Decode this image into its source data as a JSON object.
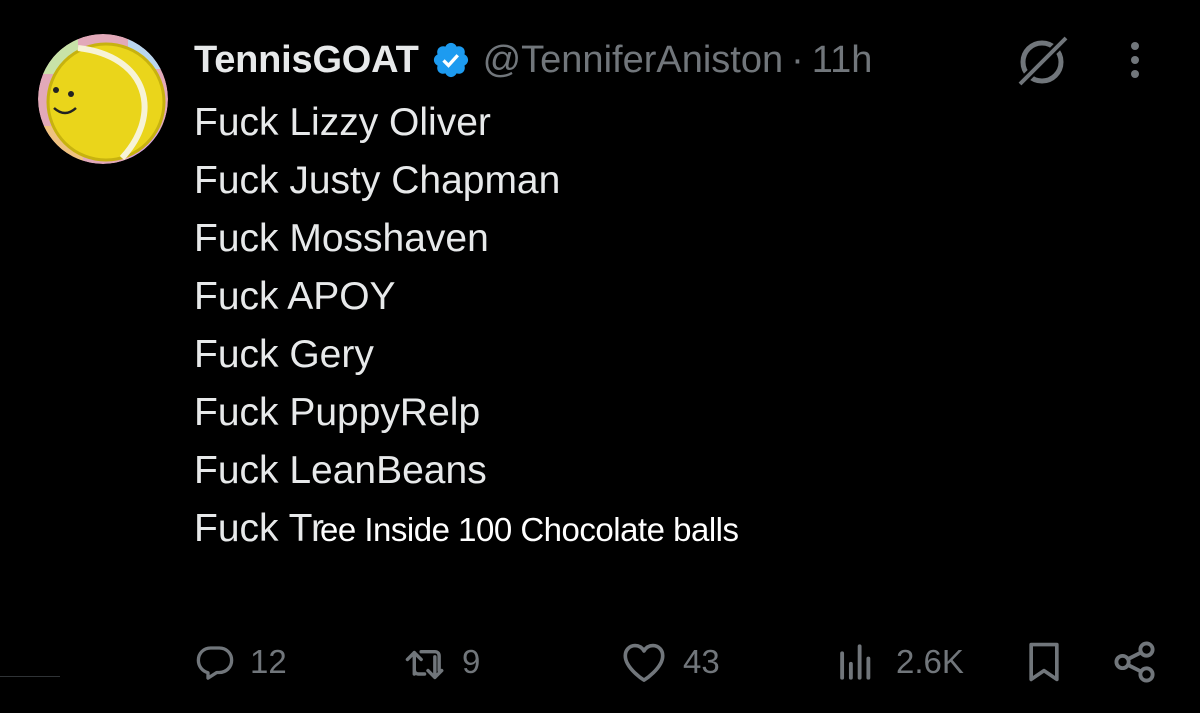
{
  "tweet": {
    "display_name": "TennisGOAT",
    "handle": "@TenniferAniston",
    "separator": "·",
    "time": "11h",
    "lines": [
      "Fuck Lizzy Oliver",
      "Fuck Justy Chapman",
      "Fuck Mosshaven",
      "Fuck APOY",
      "Fuck Gery",
      "Fuck PuppyRelp",
      "Fuck LeanBeans"
    ],
    "last_line_prefix": "Fuck Tr",
    "last_line_suffix": "ee Inside 100 Chocolate balls"
  },
  "actions": {
    "replies": "12",
    "reposts": "9",
    "likes": "43",
    "views": "2.6K"
  },
  "icons": {
    "avatar": "tennis-ball-avatar",
    "verified": "verified-badge-icon",
    "grok": "grok-icon",
    "more": "more-icon",
    "reply": "reply-icon",
    "repost": "repost-icon",
    "like": "heart-icon",
    "views": "views-icon",
    "bookmark": "bookmark-icon",
    "share": "share-icon"
  },
  "colors": {
    "background": "#000000",
    "text": "#e7e9ea",
    "secondary": "#71767b",
    "verified": "#1d9bf0",
    "ball": "#f2d21c"
  }
}
